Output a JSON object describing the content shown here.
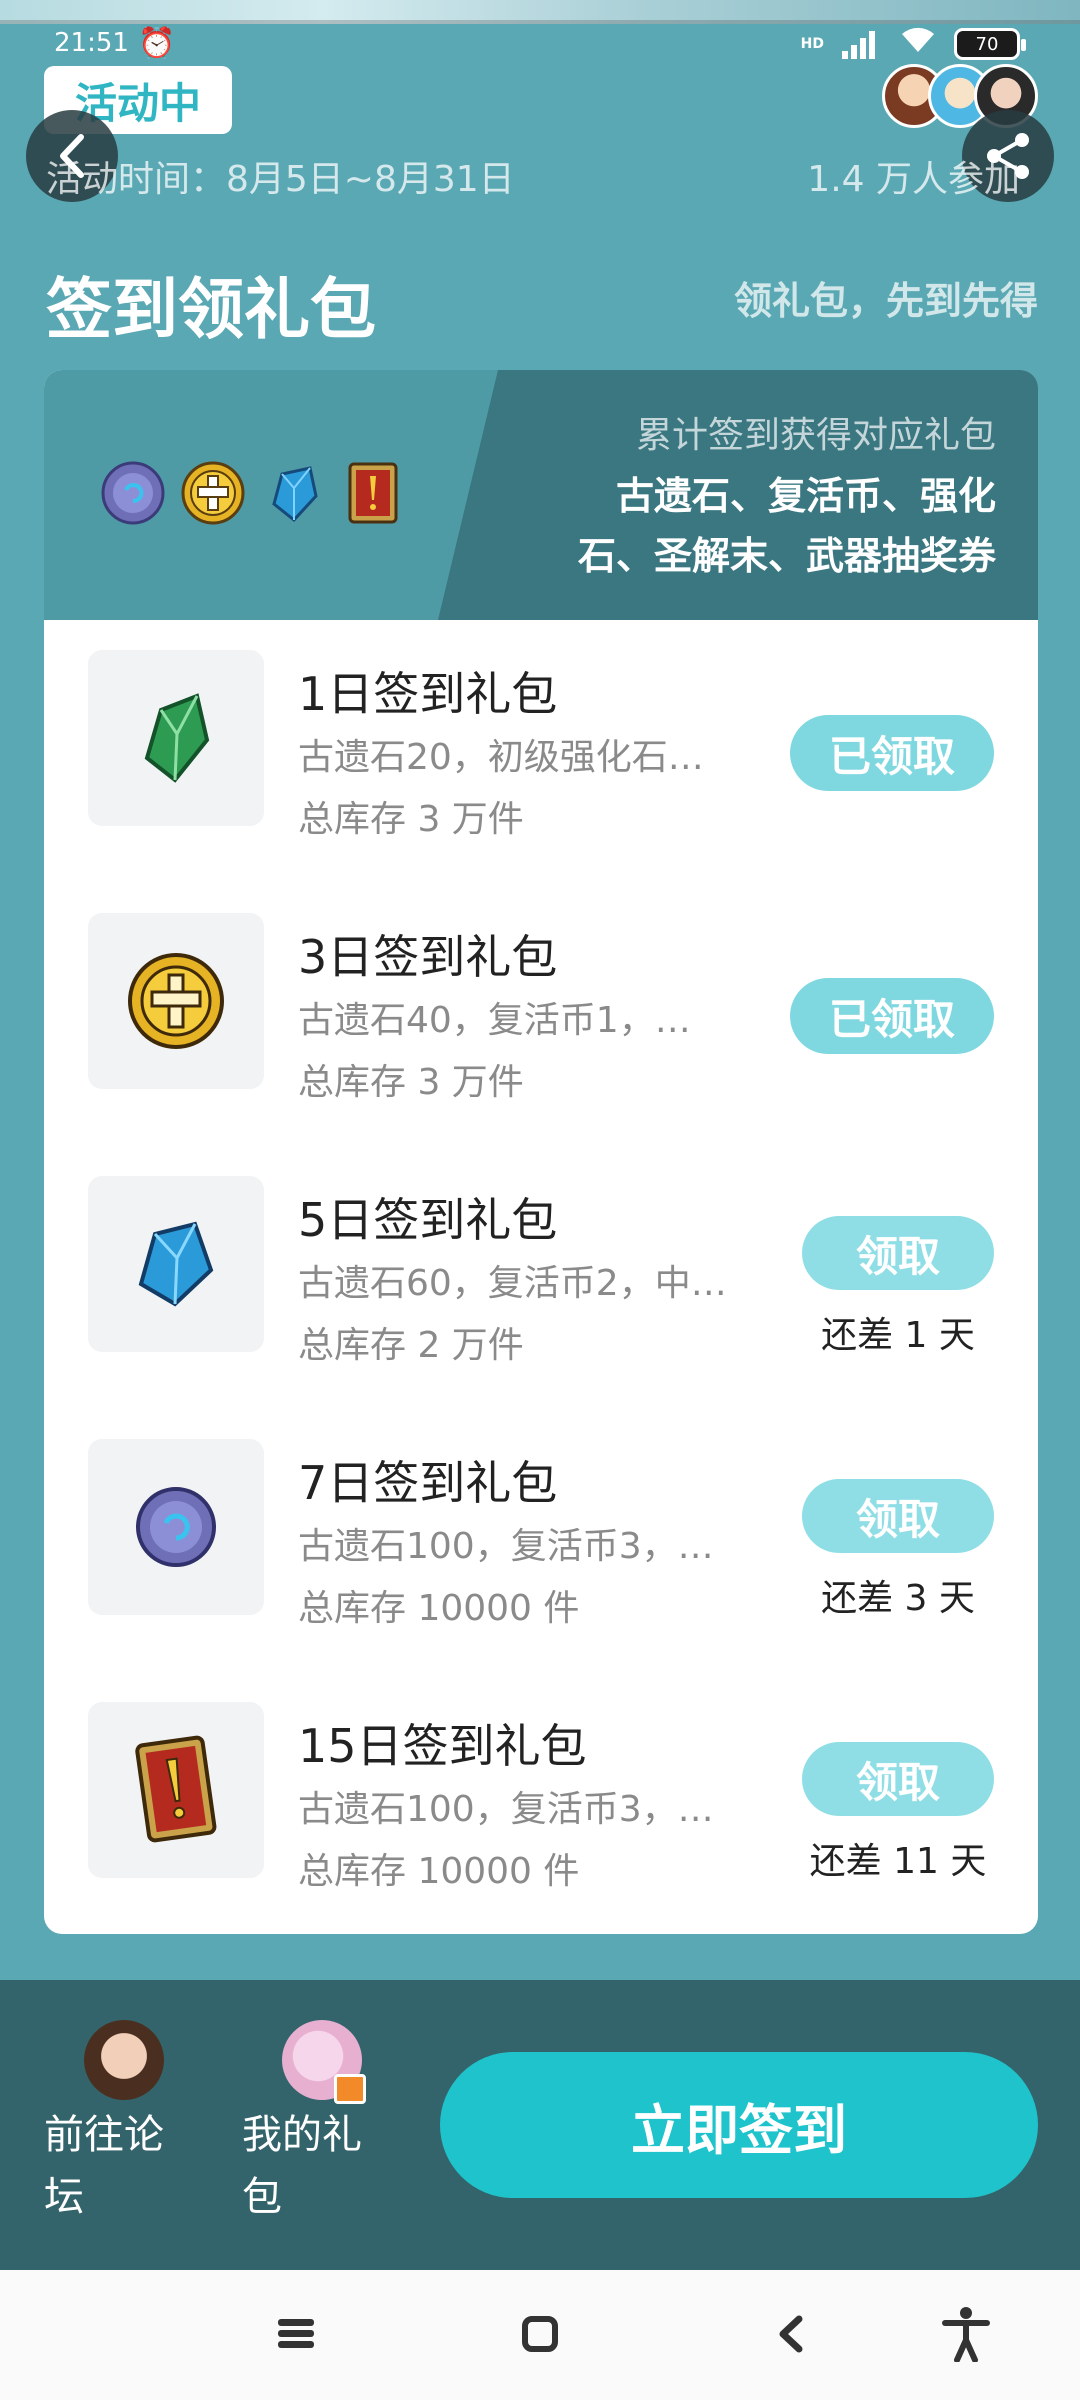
{
  "status_bar": {
    "time": "21:51",
    "hd": "HD",
    "battery": "70"
  },
  "header": {
    "badge": "活动中",
    "activity_time": "活动时间：8月5日~8月31日",
    "participants": "1.4 万人参加",
    "title": "签到领礼包",
    "subtitle": "领礼包，先到先得"
  },
  "card_header": {
    "line1": "累计签到获得对应礼包",
    "line2": "古遗石、复活币、强化",
    "line3": "石、圣解末、武器抽奖券",
    "icons": [
      "blue-coin-icon",
      "gold-cross-coin-icon",
      "blue-crystal-icon",
      "red-card-icon"
    ]
  },
  "gifts": [
    {
      "title": "1日签到礼包",
      "desc": "古遗石20，初级强化石…",
      "stock": "总库存 3 万件",
      "button": "已领取",
      "status": "claimed",
      "icon": "green-crystal-icon"
    },
    {
      "title": "3日签到礼包",
      "desc": "古遗石40，复活币1，…",
      "stock": "总库存 3 万件",
      "button": "已领取",
      "status": "claimed",
      "icon": "gold-cross-coin-icon"
    },
    {
      "title": "5日签到礼包",
      "desc": "古遗石60，复活币2，中…",
      "stock": "总库存 2 万件",
      "button": "领取",
      "days_left": "还差 1 天",
      "status": "pending",
      "icon": "blue-crystal-icon"
    },
    {
      "title": "7日签到礼包",
      "desc": "古遗石100，复活币3，…",
      "stock": "总库存 10000 件",
      "button": "领取",
      "days_left": "还差 3 天",
      "status": "pending",
      "icon": "blue-coin-icon"
    },
    {
      "title": "15日签到礼包",
      "desc": "古遗石100，复活币3，…",
      "stock": "总库存 10000 件",
      "button": "领取",
      "days_left": "还差 11 天",
      "status": "pending",
      "icon": "red-card-icon"
    }
  ],
  "action_bar": {
    "forum_line1": "前往论",
    "forum_line2": "坛",
    "gifts_line1": "我的礼",
    "gifts_line2": "包",
    "checkin": "立即签到"
  },
  "colors": {
    "page_bg": "#5aa8b3",
    "accent": "#1fc3cc",
    "claimed_btn": "#7fd8e0",
    "action_bar_bg": "#34646b"
  }
}
